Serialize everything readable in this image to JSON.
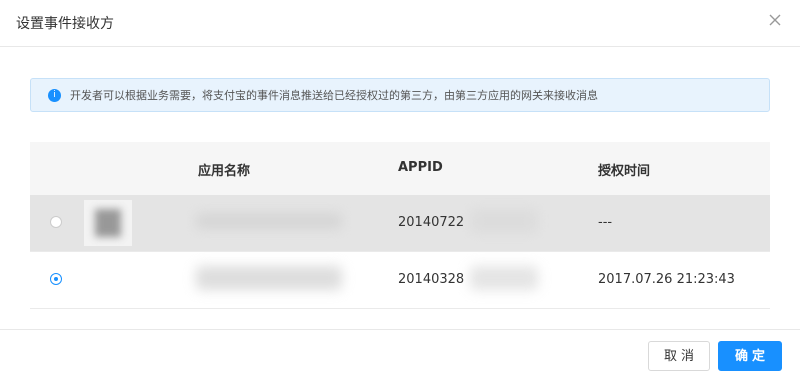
{
  "dialog": {
    "title": "设置事件接收方",
    "close_icon": "close-icon"
  },
  "info": {
    "icon_glyph": "i",
    "text": "开发者可以根据业务需要，将支付宝的事件消息推送给已经授权过的第三方，由第三方应用的网关来接收消息"
  },
  "table": {
    "headers": {
      "app_name": "应用名称",
      "appid": "APPID",
      "auth_time": "授权时间"
    },
    "rows": [
      {
        "selected": false,
        "appid": "20140722",
        "auth_time": "---"
      },
      {
        "selected": true,
        "appid": "20140328",
        "auth_time": "2017.07.26 21:23:43"
      }
    ]
  },
  "footer": {
    "cancel_label": "取消",
    "ok_label": "确定"
  },
  "colors": {
    "primary": "#1890ff",
    "info_bg": "#e8f3fd",
    "hover_row": "#e4e4e4"
  }
}
